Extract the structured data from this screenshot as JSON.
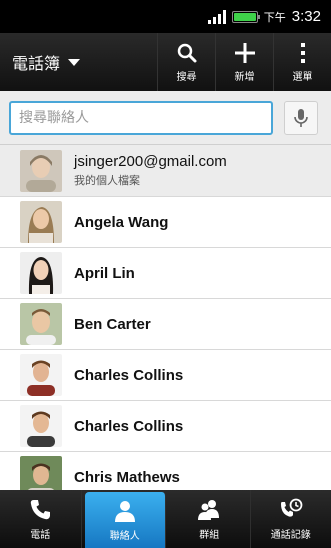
{
  "status_bar": {
    "ampm": "下午",
    "time": "3:32"
  },
  "action_bar": {
    "title": "電話簿",
    "search_label": "搜尋",
    "add_label": "新增",
    "menu_label": "選單"
  },
  "search": {
    "placeholder": "搜尋聯絡人"
  },
  "profile": {
    "email": "jsinger200@gmail.com",
    "subtitle": "我的個人檔案"
  },
  "contacts": [
    {
      "name": "Angela Wang"
    },
    {
      "name": "April Lin"
    },
    {
      "name": "Ben Carter"
    },
    {
      "name": "Charles Collins"
    },
    {
      "name": "Charles Collins"
    },
    {
      "name": "Chris Mathews"
    }
  ],
  "tabs": [
    {
      "label": "電話",
      "icon": "phone-icon"
    },
    {
      "label": "聯絡人",
      "icon": "person-icon"
    },
    {
      "label": "群組",
      "icon": "group-icon"
    },
    {
      "label": "通話記錄",
      "icon": "call-history-icon"
    }
  ],
  "colors": {
    "accent": "#49a6d8",
    "active_tab": "#2a95dc",
    "battery": "#3fd24a"
  }
}
